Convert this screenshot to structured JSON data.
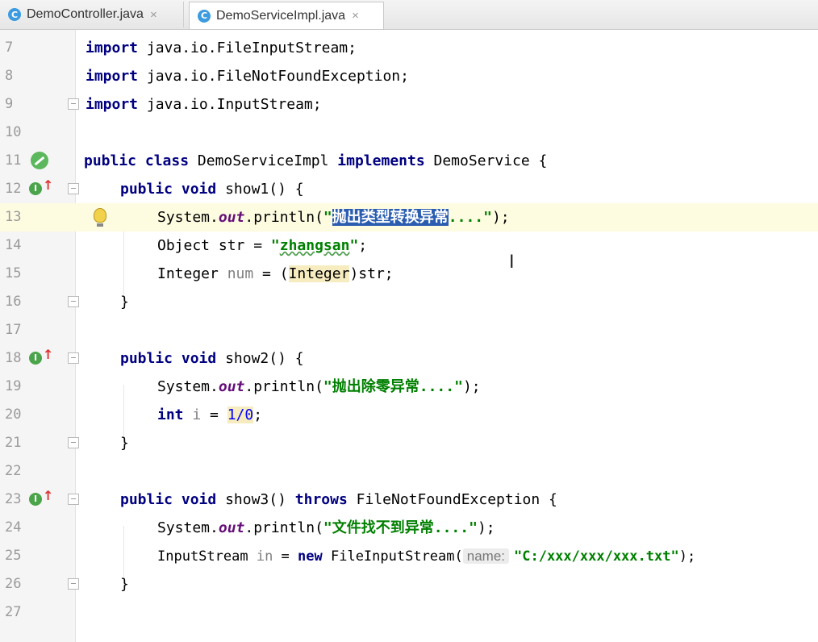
{
  "tabs": [
    {
      "icon": "C",
      "label": "DemoController.java",
      "close": "×"
    },
    {
      "icon": "C",
      "label": "DemoServiceImpl.java",
      "close": "×"
    }
  ],
  "lines": [
    {
      "n": "7"
    },
    {
      "n": "8"
    },
    {
      "n": "9"
    },
    {
      "n": "10"
    },
    {
      "n": "11"
    },
    {
      "n": "12"
    },
    {
      "n": "13"
    },
    {
      "n": "14"
    },
    {
      "n": "15"
    },
    {
      "n": "16"
    },
    {
      "n": "17"
    },
    {
      "n": "18"
    },
    {
      "n": "19"
    },
    {
      "n": "20"
    },
    {
      "n": "21"
    },
    {
      "n": "22"
    },
    {
      "n": "23"
    },
    {
      "n": "24"
    },
    {
      "n": "25"
    },
    {
      "n": "26"
    },
    {
      "n": "27"
    }
  ],
  "code": {
    "kw_import": "import",
    "l7": " java.io.FileInputStream;",
    "l8": " java.io.FileNotFoundException;",
    "l9": " java.io.InputStream;",
    "kw_public": "public",
    "kw_class": "class",
    "kw_implements": "implements",
    "kw_void": "void",
    "kw_throws": "throws",
    "kw_int": "int",
    "kw_new": "new",
    "class_name": " DemoServiceImpl ",
    "iface": " DemoService {",
    "show1": " show1() {",
    "show2": " show2() {",
    "show3": " show3() ",
    "show3_tail": " FileNotFoundException {",
    "system": "System.",
    "out": "out",
    "println": ".println(",
    "quote": "\"",
    "str13_sel": "抛出类型转换异常",
    "str13_rest": "....\"",
    "close_paren": ");",
    "l14_a": "Object str = ",
    "l14_str": "zhangsan",
    "l14_end": ";",
    "l15_a": "Integer ",
    "l15_num": "num",
    "l15_b": " = (",
    "l15_cast": "Integer",
    "l15_c": ")str;",
    "brace_close": "}",
    "str19": "\"抛出除零异常....\"",
    "l20_i": " i",
    "l20_eq": " = ",
    "l20_expr": "1/0",
    "str24": "\"文件找不到异常....\"",
    "l25_a": "InputStream ",
    "l25_in": "in",
    "l25_b": " = ",
    "l25_c": " FileInputStream(",
    "l25_hint": "name:",
    "l25_str": "\"C:/xxx/xxx/xxx.txt\""
  },
  "colors": {
    "keyword": "#000080",
    "string": "#008000",
    "selection": "#2a5db0",
    "current_line": "#fdfbe0"
  },
  "icons": [
    "class-c-icon",
    "close-tab-icon",
    "implementation-icon",
    "override-arrow-icon",
    "run-icon",
    "intention-bulb-icon",
    "fold-marker-icon",
    "text-cursor-icon"
  ]
}
